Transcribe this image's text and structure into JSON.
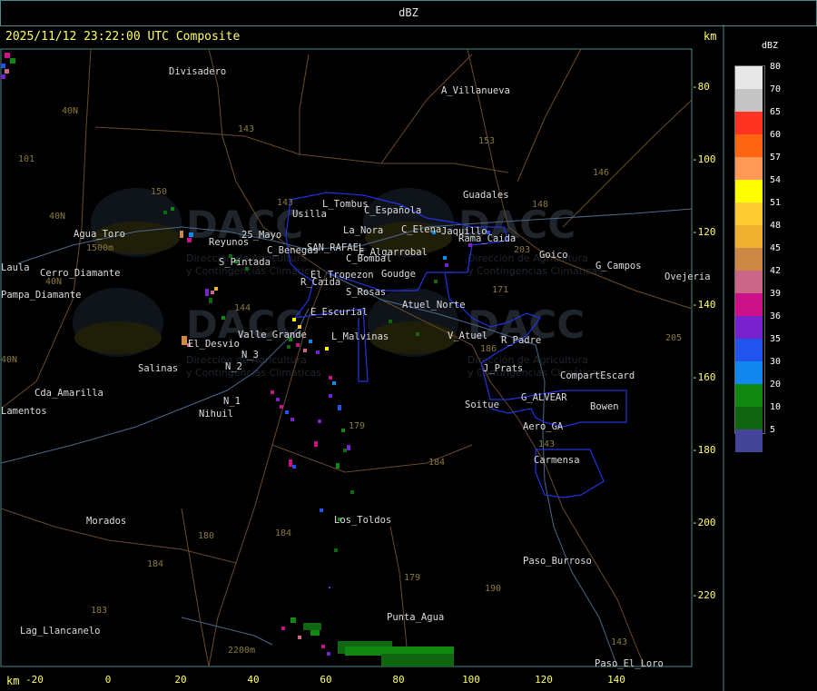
{
  "window": {
    "title": "dBZ"
  },
  "header": {
    "timestamp": "2025/11/12 23:22:00 UTC Composite",
    "units": "km"
  },
  "footer": {
    "units": "km"
  },
  "axes": {
    "x_ticks": [
      "-20",
      "0",
      "20",
      "40",
      "60",
      "80",
      "100",
      "120",
      "140"
    ],
    "y_ticks": [
      "-80",
      "-100",
      "-120",
      "-140",
      "-160",
      "-180",
      "-200",
      "-220"
    ]
  },
  "legend": {
    "title": "dBZ",
    "entries": [
      {
        "label": "80",
        "color": "#e8e8e8"
      },
      {
        "label": "70",
        "color": "#c4c4c4"
      },
      {
        "label": "65",
        "color": "#ff3322"
      },
      {
        "label": "60",
        "color": "#ff6611"
      },
      {
        "label": "57",
        "color": "#ff9955"
      },
      {
        "label": "54",
        "color": "#ffff00"
      },
      {
        "label": "51",
        "color": "#ffcc33"
      },
      {
        "label": "48",
        "color": "#f0b030"
      },
      {
        "label": "45",
        "color": "#cc8844"
      },
      {
        "label": "42",
        "color": "#cc6688"
      },
      {
        "label": "39",
        "color": "#cc1188"
      },
      {
        "label": "36",
        "color": "#7722cc"
      },
      {
        "label": "35",
        "color": "#2255ee"
      },
      {
        "label": "30",
        "color": "#1188ee"
      },
      {
        "label": "20",
        "color": "#118811"
      },
      {
        "label": "10",
        "color": "#116611"
      },
      {
        "label": "5",
        "color": "#444499"
      }
    ]
  },
  "place_labels": [
    {
      "text": "Divisadero",
      "color": "#dddddd"
    },
    {
      "text": "A_Villanueva",
      "color": "#dddddd"
    },
    {
      "text": "Guadales",
      "color": "#dddddd"
    },
    {
      "text": "L_Tombus",
      "color": "#dddddd"
    },
    {
      "text": "Usilla",
      "color": "#dddddd"
    },
    {
      "text": "La_Nora",
      "color": "#dddddd"
    },
    {
      "text": "C_Española",
      "color": "#dddddd"
    },
    {
      "text": "C_Elena",
      "color": "#dddddd"
    },
    {
      "text": "Jaquillo",
      "color": "#dddddd"
    },
    {
      "text": "Rama_Caida",
      "color": "#dddddd"
    },
    {
      "text": "Reyunos",
      "color": "#dddddd"
    },
    {
      "text": "25_Mayo",
      "color": "#dddddd"
    },
    {
      "text": "C_Benegas",
      "color": "#dddddd"
    },
    {
      "text": "SAN_RAFAEL",
      "color": "#dddddd"
    },
    {
      "text": "E_Algarrobal",
      "color": "#dddddd"
    },
    {
      "text": "C_Bombal",
      "color": "#dddddd"
    },
    {
      "text": "Goico",
      "color": "#dddddd"
    },
    {
      "text": "G_Campos",
      "color": "#dddddd"
    },
    {
      "text": "Ovejeria",
      "color": "#dddddd"
    },
    {
      "text": "S_Pintada",
      "color": "#dddddd"
    },
    {
      "text": "El_Tropezon",
      "color": "#dddddd"
    },
    {
      "text": "Goudge",
      "color": "#dddddd"
    },
    {
      "text": "R_Caida",
      "color": "#dddddd"
    },
    {
      "text": "S_Rosas",
      "color": "#dddddd"
    },
    {
      "text": "Atuel_Norte",
      "color": "#dddddd"
    },
    {
      "text": "E_Escurial",
      "color": "#dddddd"
    },
    {
      "text": "Agua_Toro",
      "color": "#dddddd"
    },
    {
      "text": "Cerro_Diamante",
      "color": "#dddddd"
    },
    {
      "text": "Pampa_Diamante",
      "color": "#dddddd"
    },
    {
      "text": "Valle_Grande",
      "color": "#dddddd"
    },
    {
      "text": "L_Malvinas",
      "color": "#dddddd"
    },
    {
      "text": "V_Atuel",
      "color": "#dddddd"
    },
    {
      "text": "R_Padre",
      "color": "#dddddd"
    },
    {
      "text": "El_Desvio",
      "color": "#dddddd"
    },
    {
      "text": "Salinas",
      "color": "#dddddd"
    },
    {
      "text": "N_3",
      "color": "#dddddd"
    },
    {
      "text": "N_2",
      "color": "#dddddd"
    },
    {
      "text": "N_1",
      "color": "#dddddd"
    },
    {
      "text": "Nihuil",
      "color": "#dddddd"
    },
    {
      "text": "J_Prats",
      "color": "#dddddd"
    },
    {
      "text": "CompartEscard",
      "color": "#dddddd"
    },
    {
      "text": "G_ALVEAR",
      "color": "#dddddd"
    },
    {
      "text": "Bowen",
      "color": "#dddddd"
    },
    {
      "text": "Soitue",
      "color": "#dddddd"
    },
    {
      "text": "Aero_GA",
      "color": "#dddddd"
    },
    {
      "text": "Carmensa",
      "color": "#dddddd"
    },
    {
      "text": "Cda_Amarilla",
      "color": "#dddddd"
    },
    {
      "text": "Lamentos",
      "color": "#dddddd"
    },
    {
      "text": "Morados",
      "color": "#dddddd"
    },
    {
      "text": "Los_Toldos",
      "color": "#dddddd"
    },
    {
      "text": "Paso_Burroso",
      "color": "#dddddd"
    },
    {
      "text": "Punta_Agua",
      "color": "#dddddd"
    },
    {
      "text": "Lag_Llancanelo",
      "color": "#dddddd"
    },
    {
      "text": "Paso_El_Loro",
      "color": "#dddddd"
    },
    {
      "text": "Laula",
      "color": "#dddddd"
    }
  ],
  "route_labels": [
    "143",
    "153",
    "146",
    "148",
    "150",
    "143",
    "203",
    "171",
    "144",
    "40N",
    "40N",
    "40N",
    "101",
    "179",
    "184",
    "180",
    "184",
    "184",
    "183",
    "179",
    "190",
    "143",
    "143",
    "186",
    "40N",
    "205"
  ],
  "elevation_labels": [
    "1500m",
    "2200m"
  ],
  "watermark": {
    "brand": "DACC",
    "line1": "Dirección de Agricultura",
    "line2": "y Contingencias Climáticas"
  },
  "colors": {
    "boundary": "#2233dd",
    "roads": "#6a4a2a",
    "rivers": "#4a6a8a",
    "grid_text": "#8a7a3a",
    "axis_text": "#ffff66",
    "frame": "#4a8a8a"
  }
}
